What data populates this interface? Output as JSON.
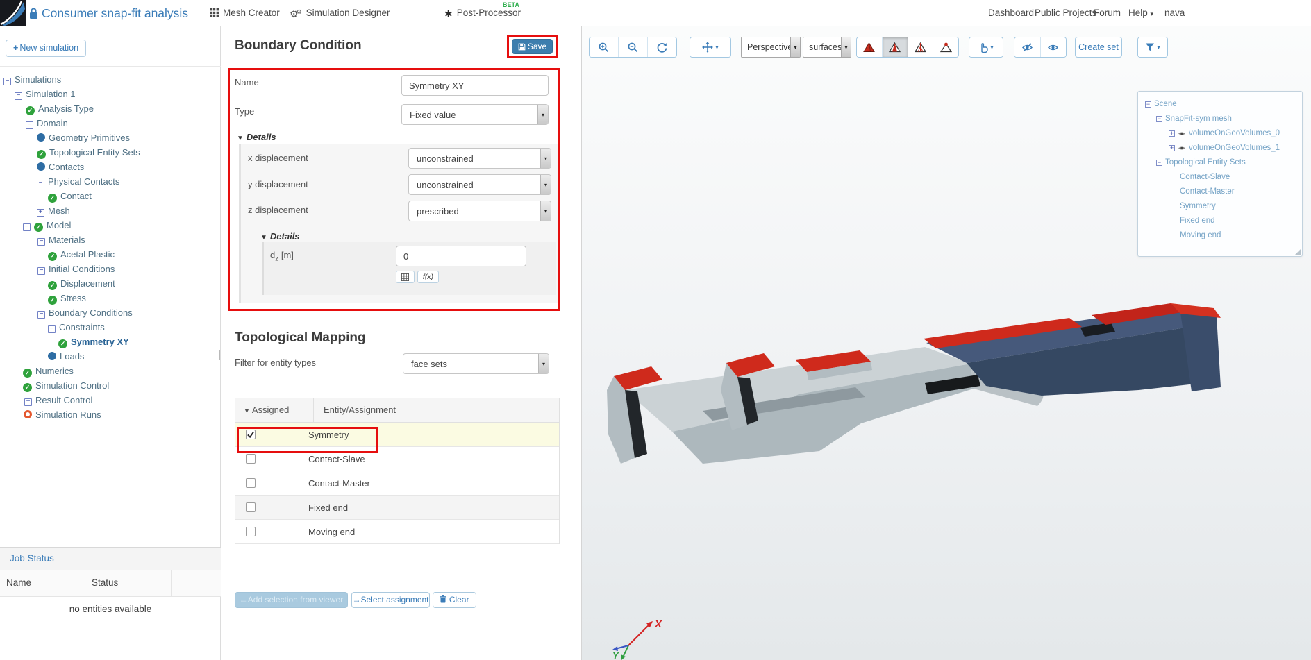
{
  "header": {
    "project_title": "Consumer snap-fit analysis",
    "mesh_creator": "Mesh Creator",
    "simulation_designer": "Simulation Designer",
    "post_processor": "Post-Processor",
    "beta": "BETA",
    "dashboard": "Dashboard",
    "public_projects": "Public Projects",
    "forum": "Forum",
    "help": "Help",
    "user": "nava"
  },
  "sidebar": {
    "new_simulation": "New simulation",
    "tree": [
      {
        "label": "Simulations"
      },
      {
        "label": "Simulation 1"
      },
      {
        "label": "Analysis Type"
      },
      {
        "label": "Domain"
      },
      {
        "label": "Geometry Primitives"
      },
      {
        "label": "Topological Entity Sets"
      },
      {
        "label": "Contacts"
      },
      {
        "label": "Physical Contacts"
      },
      {
        "label": "Contact"
      },
      {
        "label": "Mesh"
      },
      {
        "label": "Model"
      },
      {
        "label": "Materials"
      },
      {
        "label": "Acetal Plastic"
      },
      {
        "label": "Initial Conditions"
      },
      {
        "label": "Displacement"
      },
      {
        "label": "Stress"
      },
      {
        "label": "Boundary Conditions"
      },
      {
        "label": "Constraints"
      },
      {
        "label": "Symmetry XY"
      },
      {
        "label": "Loads"
      },
      {
        "label": "Numerics"
      },
      {
        "label": "Simulation Control"
      },
      {
        "label": "Result Control"
      },
      {
        "label": "Simulation Runs"
      }
    ],
    "job_status": {
      "title": "Job Status",
      "col_name": "Name",
      "col_status": "Status",
      "empty": "no entities available"
    }
  },
  "panel": {
    "title": "Boundary Condition",
    "save": "Save",
    "name_label": "Name",
    "name_value": "Symmetry XY",
    "type_label": "Type",
    "type_value": "Fixed value",
    "details_label": "Details",
    "x_label": "x displacement",
    "x_value": "unconstrained",
    "y_label": "y displacement",
    "y_value": "unconstrained",
    "z_label": "z displacement",
    "z_value": "prescribed",
    "dz_base": "d",
    "dz_sub": "z",
    "dz_unit": "[m]",
    "dz_value": "0",
    "fx_label": "f(x)",
    "topo_title": "Topological Mapping",
    "filter_label": "Filter for entity types",
    "filter_value": "face sets",
    "col_assigned": "Assigned",
    "col_entity": "Entity/Assignment",
    "rows": [
      {
        "label": "Symmetry",
        "checked": true
      },
      {
        "label": "Contact-Slave",
        "checked": false
      },
      {
        "label": "Contact-Master",
        "checked": false
      },
      {
        "label": "Fixed end",
        "checked": false
      },
      {
        "label": "Moving end",
        "checked": false
      }
    ],
    "add_selection": "Add selection from viewer",
    "select_assignment": "Select assignment",
    "clear": "Clear"
  },
  "viewer": {
    "perspective": "Perspective",
    "surfaces": "surfaces",
    "create_set": "Create set",
    "axis_x": "X",
    "axis_y": "Y",
    "scene": {
      "root": "Scene",
      "mesh": "SnapFit-sym mesh",
      "vol0": "volumeOnGeoVolumes_0",
      "vol1": "volumeOnGeoVolumes_1",
      "topo": "Topological Entity Sets",
      "sets": [
        "Contact-Slave",
        "Contact-Master",
        "Symmetry",
        "Fixed end",
        "Moving end"
      ]
    }
  },
  "colors": {
    "brand_blue": "#3a7cb8",
    "save_blue": "#3d7eae",
    "annotation_red": "#e60e0e",
    "check_green": "#2fa23c",
    "node_blue": "#2e6da4",
    "runs_orange": "#e4572e",
    "model_gray": "#c9d0d3",
    "model_blue": "#46597b",
    "model_red": "#cf2a1c",
    "beta_green": "#2fae4e"
  }
}
